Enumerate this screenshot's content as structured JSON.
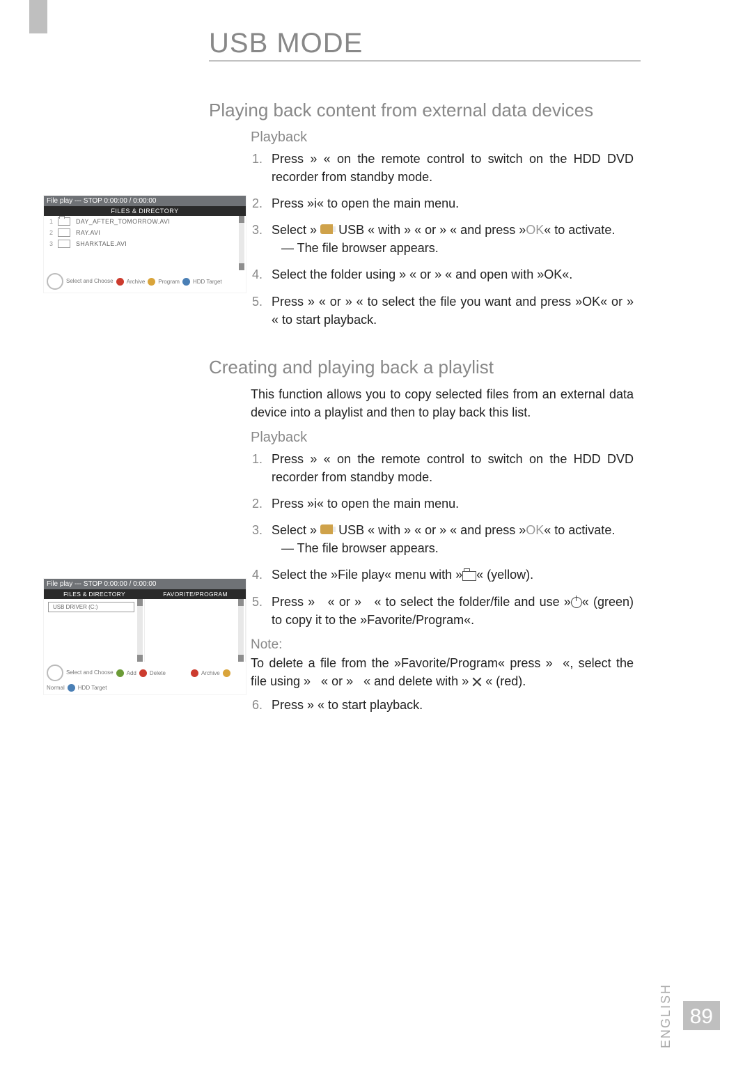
{
  "section_title": "USB MODE",
  "subtitle1": "Playing back content from external data devices",
  "sub1_header": "Playback",
  "sub1_steps": [
    "Press » « on the remote control to switch on the HDD DVD recorder from standby mode.",
    "Press »i« to open the main menu.",
    "Select_usb_row",
    "Select the folder using »    « or »    « and open with »OK«.",
    "Press »    « or »    « to select the file you want and press »OK« or »    « to start playback."
  ],
  "usb_row_pre": "Select »",
  "usb_label": "USB",
  "usb_row_mid": "« with »    « or »    « and press »",
  "ok_label": "OK",
  "usb_row_post": "« to activate.",
  "file_browser_line": "— The file browser appears.",
  "subtitle2": "Creating and playing back a playlist",
  "subtitle2_desc": "This function allows you to copy selected files from an external data device into a playlist and then to play back this list.",
  "sub2_header": "Playback",
  "sub2_steps": [
    "Press » « on the remote control to switch on the HDD DVD recorder from standby mode.",
    "Press »i« to open the main menu.",
    "Select_usb_row",
    "Select the »File play« menu with »folder_icon« (yellow).",
    "Press »    « or »    « to select the folder/file and use »power_icon« (green) to copy it to the »Favorite/Program«."
  ],
  "note_label": "Note:",
  "note_body": "To delete a file from the »Favorite/Program« press »  «, select the file using »    « or »    « and delete with » x_icon « (red).",
  "step6": "Press »   « to start playback.",
  "panel1": {
    "topbar": "File play --- STOP    0:00:00 / 0:00:00",
    "header": "FILES & DIRECTORY",
    "files": [
      {
        "idx": "1",
        "name": "DAY_AFTER_TOMORROW.AVI"
      },
      {
        "idx": "2",
        "name": "RAY.AVI"
      },
      {
        "idx": "3",
        "name": "SHARKTALE.AVI"
      }
    ],
    "footer_select": "Select and Choose",
    "footer_archive": "Archive",
    "footer_program": "Program",
    "footer_hdd": "HDD Target"
  },
  "panel2": {
    "topbar": "File play --- STOP    0:00:00 / 0:00:00",
    "header_left": "FILES & DIRECTORY",
    "header_right": "FAVORITE/PROGRAM",
    "entry": "USB DRIVER (C:)",
    "footer_select": "Select and Choose",
    "footer_add": "Add",
    "footer_delete": "Delete",
    "footer_archive": "Archive",
    "footer_normal": "Normal",
    "footer_hdd": "HDD Target"
  },
  "lang": "ENGLISH",
  "page_num": "89"
}
